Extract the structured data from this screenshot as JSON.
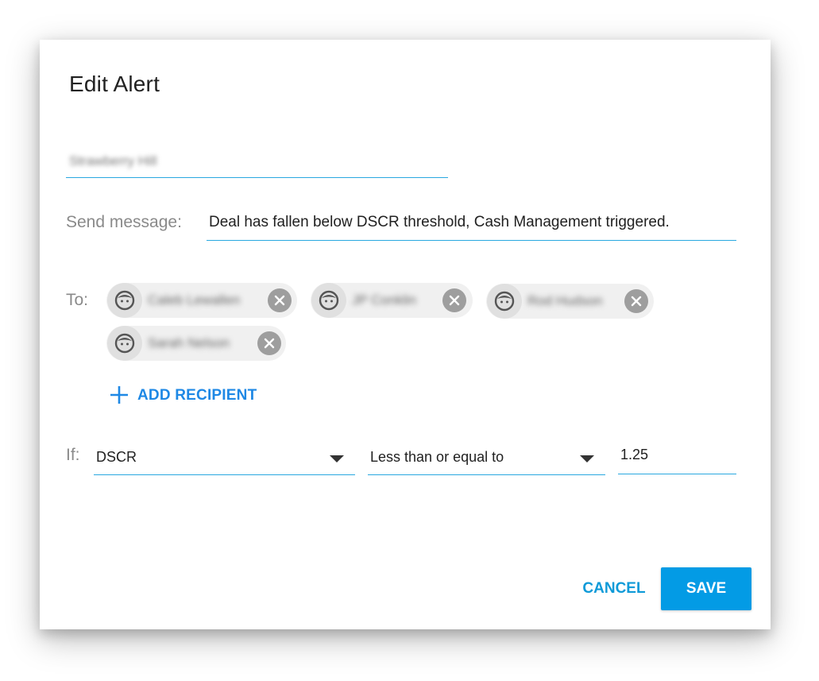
{
  "dialog": {
    "title": "Edit Alert",
    "alert_name": "Strawberry Hill",
    "send_message_label": "Send message:",
    "send_message_value": "Deal has fallen below DSCR threshold, Cash Management triggered.",
    "to_label": "To:",
    "recipients": [
      {
        "name": "Caleb Lewallen"
      },
      {
        "name": "JP Conklin"
      },
      {
        "name": "Rod Hudson"
      },
      {
        "name": "Sarah Nelson"
      }
    ],
    "add_recipient_label": "ADD RECIPIENT",
    "if_label": "If:",
    "metric_select": "DSCR",
    "operator_select": "Less than or equal to",
    "threshold_value": "1.25",
    "cancel_label": "CANCEL",
    "save_label": "SAVE"
  },
  "icons": {
    "avatar": "face-icon",
    "remove": "close-circle-icon",
    "add": "plus-icon",
    "dropdown": "caret-down-icon"
  },
  "colors": {
    "accent": "#1e88e5",
    "primary_button": "#039be5",
    "underline": "#29a8e0"
  }
}
